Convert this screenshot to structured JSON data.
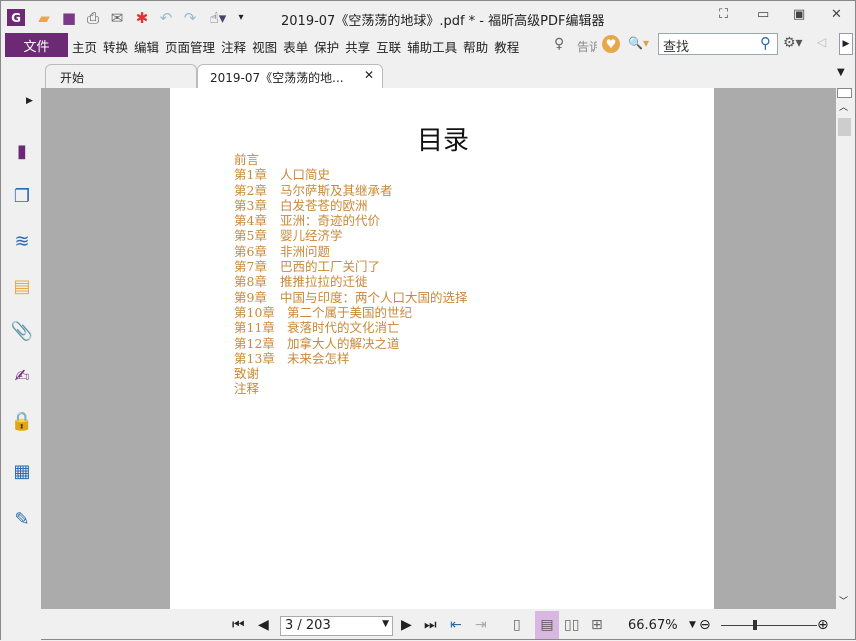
{
  "window": {
    "title": "2019-07《空荡荡的地球》.pdf * - 福昕高级PDF编辑器"
  },
  "quick_access": [
    "app-logo",
    "open-folder",
    "save",
    "print",
    "email",
    "new",
    "undo",
    "redo",
    "hand-tool",
    "customize"
  ],
  "menu": {
    "file": "文件",
    "items": [
      "主页",
      "转换",
      "编辑",
      "页面管理",
      "注释",
      "视图",
      "表单",
      "保护",
      "共享",
      "互联",
      "辅助工具",
      "帮助",
      "教程"
    ],
    "tell_me": "告诉",
    "search_placeholder": "查找"
  },
  "tabs": [
    {
      "label": "开始",
      "active": false
    },
    {
      "label": "2019-07《空荡荡的地...",
      "active": true
    }
  ],
  "document": {
    "title": "目录",
    "toc": [
      {
        "ch": "前言",
        "title": ""
      },
      {
        "ch": "第1章",
        "title": "人口简史"
      },
      {
        "ch": "第2章",
        "title": "马尔萨斯及其继承者"
      },
      {
        "ch": "第3章",
        "title": "白发苍苍的欧洲"
      },
      {
        "ch": "第4章",
        "title": "亚洲：奇迹的代价"
      },
      {
        "ch": "第5章",
        "title": "婴儿经济学"
      },
      {
        "ch": "第6章",
        "title": "非洲问题"
      },
      {
        "ch": "第7章",
        "title": "巴西的工厂关门了"
      },
      {
        "ch": "第8章",
        "title": "推推拉拉的迁徙"
      },
      {
        "ch": "第9章",
        "title": "中国与印度：两个人口大国的选择"
      },
      {
        "ch": "第10章",
        "title": "第二个属于美国的世纪"
      },
      {
        "ch": "第11章",
        "title": "衰落时代的文化消亡"
      },
      {
        "ch": "第12章",
        "title": "加拿大人的解决之道"
      },
      {
        "ch": "第13章",
        "title": "未来会怎样"
      },
      {
        "ch": "致谢",
        "title": ""
      },
      {
        "ch": "注释",
        "title": ""
      }
    ],
    "link_color": "#c8893a"
  },
  "status": {
    "page": "3 / 203",
    "zoom": "66.67%",
    "zoom_slider_fraction": 0.35
  },
  "colors": {
    "accent": "#6b2a73",
    "viewer_bg": "#ababab"
  }
}
